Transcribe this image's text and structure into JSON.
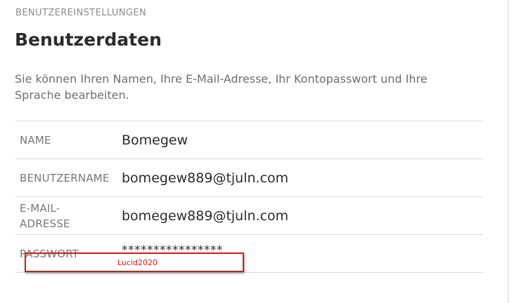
{
  "section_label": "BENUTZEREINSTELLUNGEN",
  "title": "Benutzerdaten",
  "description": "Sie können Ihren Namen, Ihre E-Mail-Adresse, Ihr Kontopasswort und Ihre Sprache bearbeiten.",
  "fields": [
    {
      "label": "NAME",
      "value": "Bomegew"
    },
    {
      "label": "BENUTZERNAME",
      "value": "bomegew889@tjuln.com"
    },
    {
      "label": "E-MAIL-ADRESSE",
      "value": "bomegew889@tjuln.com"
    },
    {
      "label": "PASSWORT",
      "value": "****************"
    }
  ],
  "annotation": {
    "text": "Lucid2020",
    "color": "#d81818"
  }
}
